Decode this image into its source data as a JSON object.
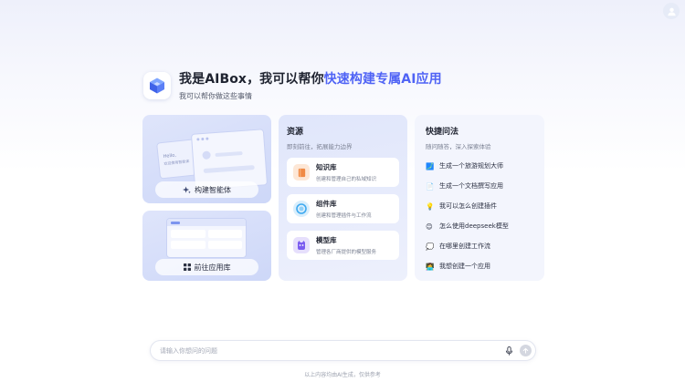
{
  "header": {
    "title_prefix": "我是AIBox，我可以帮你",
    "title_highlight": "快速构建专属AI应用",
    "subtitle": "我可以帮你做这些事情"
  },
  "build_card": {
    "button_label": "构建智能体",
    "mock_text_line1": "Hello,",
    "mock_text_line2": "欢迎使用智能体"
  },
  "app_card": {
    "button_label": "前往应用库"
  },
  "resources": {
    "title": "资源",
    "subtitle": "即刻前往，拓展能力边界",
    "items": [
      {
        "name": "知识库",
        "desc": "创建和管理自己的私域知识",
        "color": "#f08a45"
      },
      {
        "name": "组件库",
        "desc": "创建和管理插件与工作流",
        "color": "#3da9f0"
      },
      {
        "name": "模型库",
        "desc": "管理各厂商提供的模型服务",
        "color": "#7b5cf0"
      }
    ]
  },
  "quick": {
    "title": "快捷问法",
    "subtitle": "随问随答，深入探索体验",
    "items": [
      {
        "icon": "🗾",
        "label": "生成一个旅游规划大师"
      },
      {
        "icon": "📄",
        "label": "生成一个文档撰写应用"
      },
      {
        "icon": "💡",
        "label": "我可以怎么创建插件"
      },
      {
        "icon": "😊",
        "label": "怎么使用deepseek模型"
      },
      {
        "icon": "💭",
        "label": "在哪里创建工作流"
      },
      {
        "icon": "👩‍💻",
        "label": "我想创建一个应用"
      }
    ]
  },
  "input": {
    "placeholder": "请输入你想问的问题"
  },
  "footer": {
    "disclaimer": "以上内容均由AI生成，仅供参考"
  },
  "colors": {
    "accent": "#4f63f5"
  }
}
